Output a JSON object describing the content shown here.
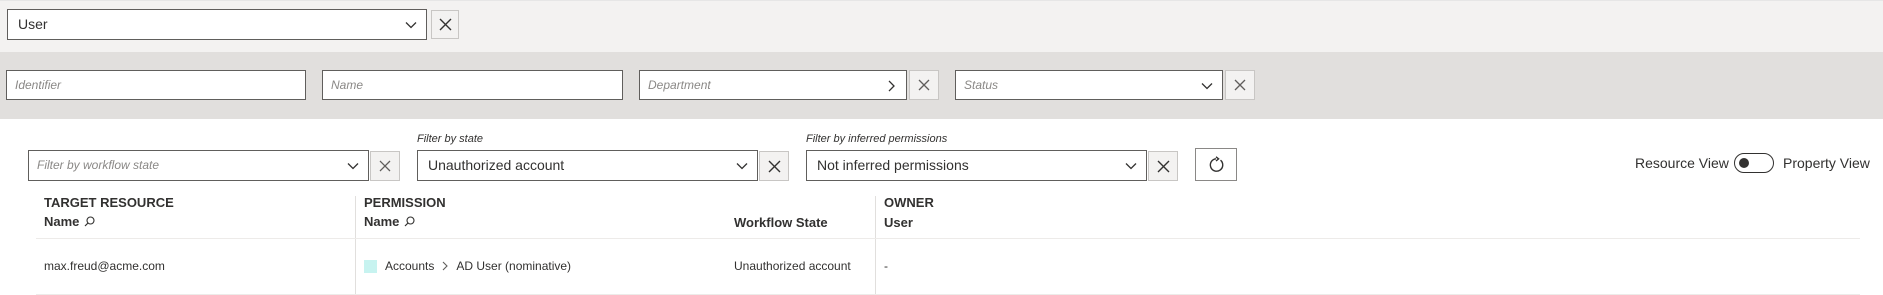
{
  "entity_selector": {
    "value": "User"
  },
  "search_filters": {
    "identifier_placeholder": "Identifier",
    "name_placeholder": "Name",
    "department_placeholder": "Department",
    "status_placeholder": "Status"
  },
  "grid_filters": {
    "workflow_state_placeholder": "Filter by workflow state",
    "state_caption": "Filter by state",
    "state_value": "Unauthorized account",
    "inferred_caption": "Filter by inferred permissions",
    "inferred_value": "Not inferred permissions"
  },
  "view_toggle": {
    "left_label": "Resource View",
    "right_label": "Property View"
  },
  "table": {
    "headers": {
      "target_resource": "TARGET RESOURCE",
      "target_resource_sub": "Name",
      "permission": "PERMISSION",
      "permission_sub": "Name",
      "workflow_state": "Workflow State",
      "owner": "OWNER",
      "owner_sub": "User"
    },
    "rows": [
      {
        "target": "max.freud@acme.com",
        "perm_category": "Accounts",
        "perm_name": "AD User (nominative)",
        "workflow_state": "Unauthorized account",
        "owner": "-"
      }
    ]
  },
  "colors": {
    "border": "#605e5c",
    "band": "#e1dfdd",
    "chip": "#c7f3f0"
  }
}
